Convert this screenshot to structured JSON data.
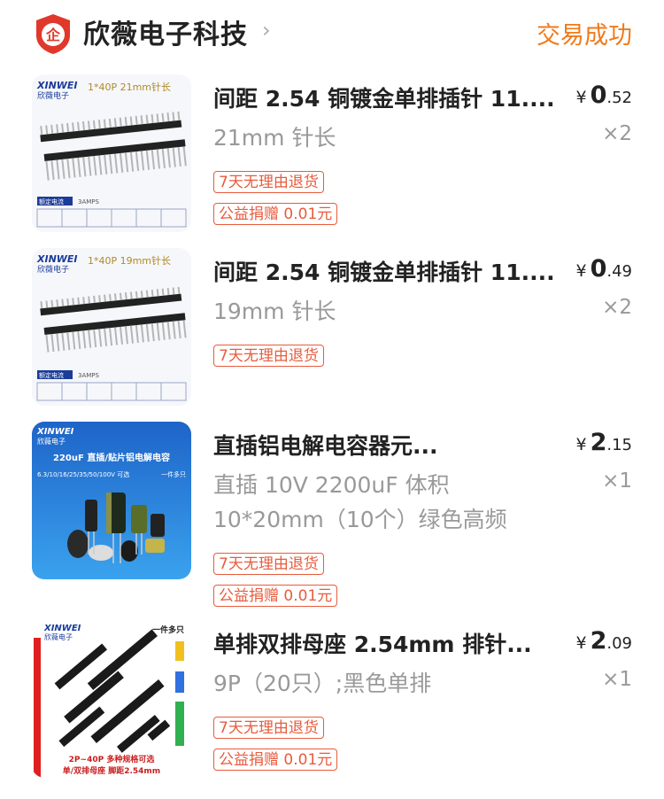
{
  "shop": {
    "name": "欣薇电子科技",
    "logo_text": "企",
    "status": "交易成功"
  },
  "items": [
    {
      "title": "间距 2.54 铜镀金单排插针 11....",
      "spec_lines": [
        "21mm 针长"
      ],
      "price": {
        "currency": "¥",
        "int": "0",
        "dec": ".52"
      },
      "qty": "×2",
      "tags": [
        "7天无理由退货",
        "公益捐赠 0.01元"
      ],
      "thumb": {
        "brand": "XINWEI",
        "brand_sub": "欣薇电子",
        "caption": "1*40P 21mm针长",
        "spec_label": "额定电流",
        "spec_value": "3AMPS"
      }
    },
    {
      "title": "间距 2.54 铜镀金单排插针 11....",
      "spec_lines": [
        "19mm 针长"
      ],
      "price": {
        "currency": "¥",
        "int": "0",
        "dec": ".49"
      },
      "qty": "×2",
      "tags": [
        "7天无理由退货"
      ],
      "thumb": {
        "brand": "XINWEI",
        "brand_sub": "欣薇电子",
        "caption": "1*40P 19mm针长",
        "spec_label": "额定电流",
        "spec_value": "3AMPS"
      }
    },
    {
      "title": "直插铝电解电容器元...",
      "spec_lines": [
        "直插 10V 2200uF 体积",
        "10*20mm（10个）绿色高频"
      ],
      "price": {
        "currency": "¥",
        "int": "2",
        "dec": ".15"
      },
      "qty": "×1",
      "tags": [
        "7天无理由退货",
        "公益捐赠 0.01元"
      ],
      "thumb": {
        "brand": "XINWEI",
        "brand_sub": "欣薇电子",
        "caption": "220uF 直插/贴片铝电解电容",
        "voltages": "6.3/10/16/25/35/50/100V 可选",
        "badge": "一件多只"
      }
    },
    {
      "title": "单排双排母座 2.54mm 排针...",
      "spec_lines": [
        "9P（20只）;黑色单排"
      ],
      "price": {
        "currency": "¥",
        "int": "2",
        "dec": ".09"
      },
      "qty": "×1",
      "tags": [
        "7天无理由退货",
        "公益捐赠 0.01元"
      ],
      "thumb": {
        "brand": "XINWEI",
        "brand_sub": "欣薇电子",
        "badge": "一件多只",
        "caption": "2P~40P 多种规格可选",
        "caption2": "单/双排母座 脚距2.54mm"
      }
    }
  ]
}
